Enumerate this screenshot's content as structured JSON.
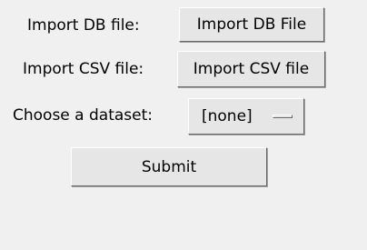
{
  "form": {
    "db_label": "Import DB file:",
    "db_button": "Import DB File",
    "csv_label": "Import CSV file:",
    "csv_button": "Import CSV file",
    "dataset_label": "Choose a dataset:",
    "dataset_selected": "[none]",
    "submit_button": "Submit"
  },
  "colors": {
    "window_bg": "#f0f0f0",
    "button_bg": "#e6e6e6"
  }
}
